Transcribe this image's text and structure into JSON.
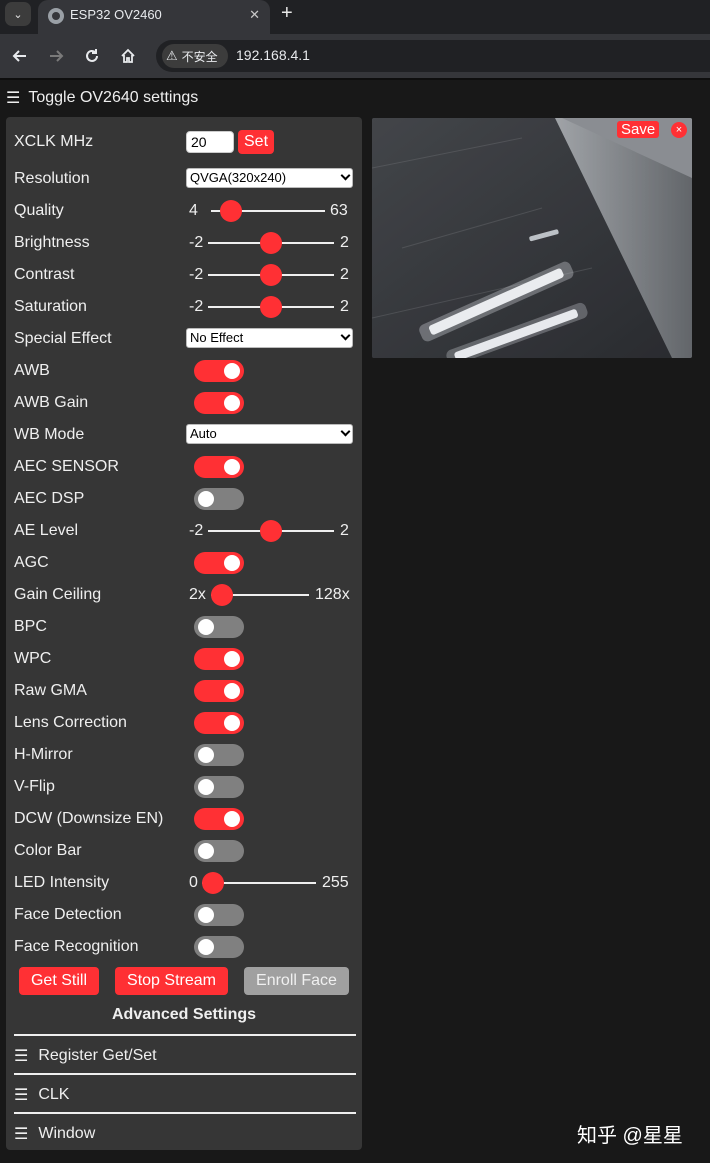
{
  "browser": {
    "tab_title": "ESP32 OV2460",
    "security_label": "不安全",
    "url": "192.168.4.1"
  },
  "toggle_label": "Toggle OV2640 settings",
  "xclk": {
    "label": "XCLK MHz",
    "value": "20",
    "button": "Set"
  },
  "resolution": {
    "label": "Resolution",
    "selected": "QVGA(320x240)"
  },
  "ranges": [
    {
      "key": "quality",
      "label": "Quality",
      "min": "4",
      "max": "63",
      "value": 10,
      "vmin": 4,
      "vmax": 63
    },
    {
      "key": "brightness",
      "label": "Brightness",
      "min": "-2",
      "max": "2",
      "value": 0,
      "vmin": -2,
      "vmax": 2
    },
    {
      "key": "contrast",
      "label": "Contrast",
      "min": "-2",
      "max": "2",
      "value": 0,
      "vmin": -2,
      "vmax": 2
    },
    {
      "key": "saturation",
      "label": "Saturation",
      "min": "-2",
      "max": "2",
      "value": 0,
      "vmin": -2,
      "vmax": 2
    },
    {
      "key": "ae-level",
      "label": "AE Level",
      "min": "-2",
      "max": "2",
      "value": 0,
      "vmin": -2,
      "vmax": 2
    },
    {
      "key": "gain-ceiling",
      "label": "Gain Ceiling",
      "min": "2x",
      "max": "128x",
      "value": 0,
      "vmin": 0,
      "vmax": 6
    },
    {
      "key": "led-intensity",
      "label": "LED Intensity",
      "min": "0",
      "max": "255",
      "value": 0,
      "vmin": 0,
      "vmax": 255
    }
  ],
  "special_effect": {
    "label": "Special Effect",
    "selected": "No Effect"
  },
  "wb_mode": {
    "label": "WB Mode",
    "selected": "Auto"
  },
  "toggles": [
    {
      "key": "awb",
      "label": "AWB",
      "on": true
    },
    {
      "key": "awb-gain",
      "label": "AWB Gain",
      "on": true
    },
    {
      "key": "aec-sensor",
      "label": "AEC SENSOR",
      "on": true
    },
    {
      "key": "aec-dsp",
      "label": "AEC DSP",
      "on": false
    },
    {
      "key": "agc",
      "label": "AGC",
      "on": true
    },
    {
      "key": "bpc",
      "label": "BPC",
      "on": false
    },
    {
      "key": "wpc",
      "label": "WPC",
      "on": true
    },
    {
      "key": "raw-gma",
      "label": "Raw GMA",
      "on": true
    },
    {
      "key": "lens-correction",
      "label": "Lens Correction",
      "on": true
    },
    {
      "key": "h-mirror",
      "label": "H-Mirror",
      "on": false
    },
    {
      "key": "v-flip",
      "label": "V-Flip",
      "on": false
    },
    {
      "key": "dcw",
      "label": "DCW (Downsize EN)",
      "on": true
    },
    {
      "key": "color-bar",
      "label": "Color Bar",
      "on": false
    },
    {
      "key": "face-detection",
      "label": "Face Detection",
      "on": false
    },
    {
      "key": "face-recognition",
      "label": "Face Recognition",
      "on": false
    }
  ],
  "buttons": {
    "get_still": "Get Still",
    "stop_stream": "Stop Stream",
    "enroll_face": "Enroll Face"
  },
  "advanced_title": "Advanced Settings",
  "sections": [
    "Register Get/Set",
    "CLK",
    "Window"
  ],
  "stream": {
    "save_label": "Save",
    "close_label": "×"
  },
  "watermark": "知乎 @星星",
  "colors": {
    "accent": "#ff3034",
    "panel": "#363636",
    "background": "#181818",
    "switch_off": "#808080"
  },
  "icons": {
    "menu": "hamburger-icon",
    "back": "arrow-left-icon",
    "forward": "arrow-right-icon",
    "reload": "reload-icon",
    "home": "home-icon",
    "warning": "warning-icon"
  }
}
